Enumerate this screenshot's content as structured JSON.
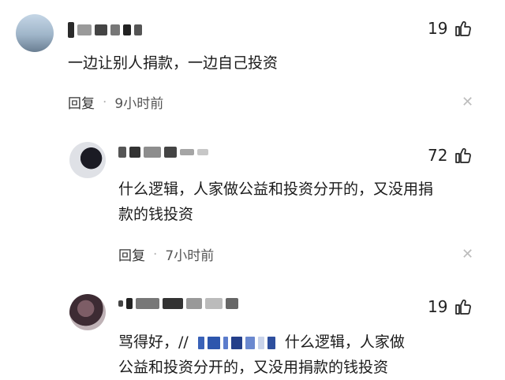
{
  "comments": [
    {
      "likes": "19",
      "text": "一边让别人捐款，一边自己投资",
      "reply_label": "回复",
      "time": "9小时前"
    },
    {
      "likes": "72",
      "text_line1": "什么逻辑，人家做公益和投资分开的，又没用捐",
      "text_line2": "款的钱投资",
      "reply_label": "回复",
      "time": "7小时前"
    },
    {
      "likes": "19",
      "text_prefix": "骂得好，//",
      "text_suffix": "什么逻辑，人家做",
      "text_line2": "公益和投资分开的，又没用捐款的钱投资"
    }
  ],
  "separator": "·",
  "icons": {
    "like": "thumbs-up-icon",
    "close": "close-icon"
  }
}
